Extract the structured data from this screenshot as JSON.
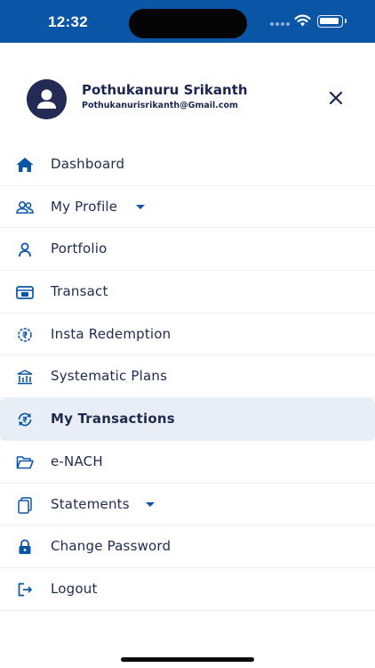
{
  "status_bar": {
    "time": "12:32"
  },
  "profile": {
    "name": "Pothukanuru Srikanth",
    "email": "Pothukanurisrikanth@Gmail.com"
  },
  "colors": {
    "brand_blue": "#0b55a6",
    "text_navy": "#1f2a4f",
    "active_row_bg": "#e9eef6"
  },
  "menu": {
    "items": [
      {
        "label": "Dashboard",
        "icon": "home-icon"
      },
      {
        "label": "My Profile",
        "icon": "users-icon",
        "has_dropdown": true
      },
      {
        "label": "Portfolio",
        "icon": "person-icon"
      },
      {
        "label": "Transact",
        "icon": "cash-register-icon"
      },
      {
        "label": "Insta Redemption",
        "icon": "rupee-cycle-icon"
      },
      {
        "label": "Systematic Plans",
        "icon": "bank-chart-icon"
      },
      {
        "label": "My Transactions",
        "icon": "rupee-refresh-icon",
        "active": true
      },
      {
        "label": "e-NACH",
        "icon": "folder-open-icon"
      },
      {
        "label": "Statements",
        "icon": "documents-icon",
        "has_dropdown": true
      },
      {
        "label": "Change Password",
        "icon": "lock-icon"
      },
      {
        "label": "Logout",
        "icon": "logout-icon"
      }
    ]
  }
}
